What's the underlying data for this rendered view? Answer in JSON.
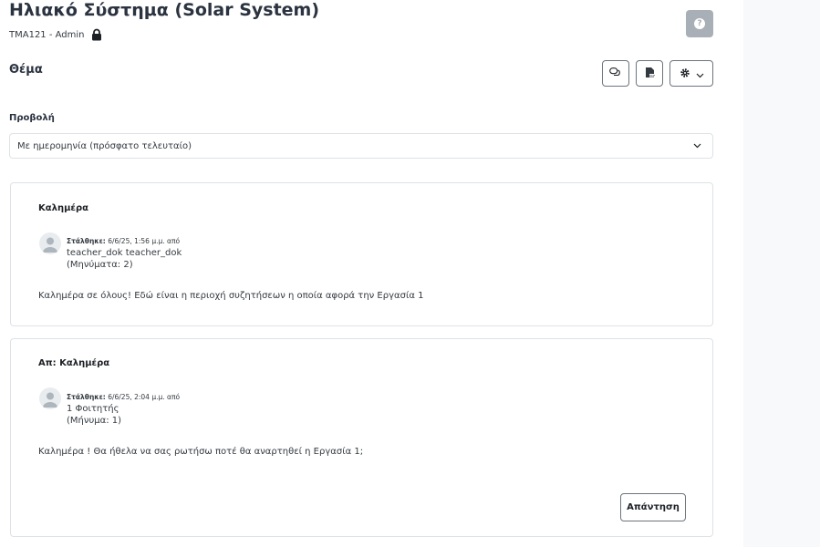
{
  "page": {
    "title": "Ηλιακό Σύστημα (Solar System)",
    "subtitle": "TMA121 - Admin",
    "section_title": "Θέμα"
  },
  "toolbar": {
    "discussion_icon": "discussion-icon",
    "pdf_icon": "pdf-export-icon",
    "settings_icon": "gear-icon",
    "help_icon": "question-icon"
  },
  "view": {
    "label": "Προβολή",
    "selected": "Με ημερομηνία (πρόσφατο τελευταίο)"
  },
  "posts": [
    {
      "subject": "Καλημέρα",
      "posted_label": "Στάλθηκε:",
      "posted_rest": " 6/6/25, 1:56 μ.μ. από",
      "author": "teacher_dok teacher_dok",
      "messages": "(Μηνύματα: 2)",
      "body": "Καλημέρα σε όλους! Εδώ είναι η περιοχή συζητήσεων η οποία αφορά την Εργασία 1"
    },
    {
      "subject": "Απ: Καλημέρα",
      "posted_label": "Στάλθηκε:",
      "posted_rest": " 6/6/25, 2:04 μ.μ. από",
      "author": "1 Φοιτητής",
      "messages": "(Μήνυμα: 1)",
      "body": "Καλημέρα ! Θα ήθελα να σας ρωτήσω ποτέ θα αναρτηθεί η Εργασία 1;",
      "reply_label": "Απάντηση"
    }
  ],
  "colors": {
    "title": "#2b3340",
    "help_button": "#a9afb6",
    "border": "#dee2e6",
    "button_border": "#6c757d"
  }
}
